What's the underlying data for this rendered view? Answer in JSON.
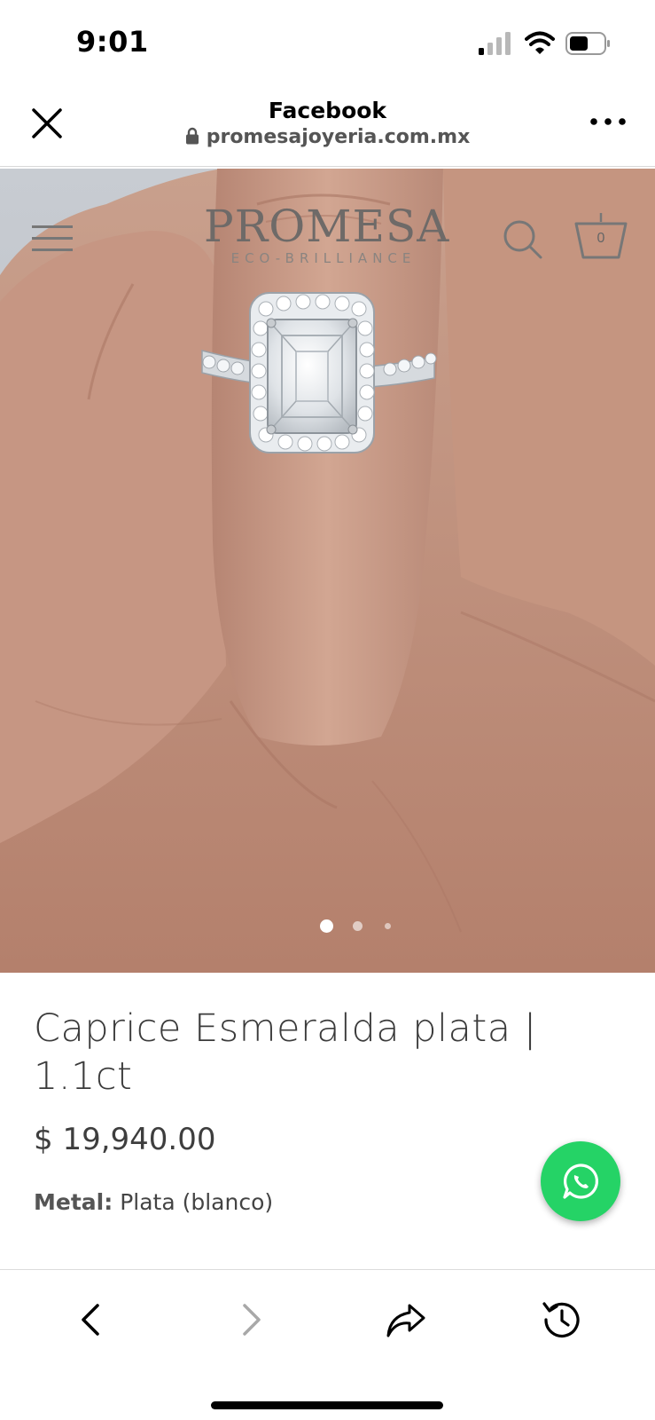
{
  "status_bar": {
    "time": "9:01",
    "icons": [
      "cellular-signal-icon",
      "wifi-icon",
      "battery-icon"
    ]
  },
  "browser_header": {
    "title": "Facebook",
    "url": "promesajoyeria.com.mx",
    "icons": [
      "close-icon",
      "lock-icon",
      "more-icon"
    ]
  },
  "site": {
    "logo_main": "PROMESA",
    "logo_sub": "ECO-BRILLIANCE",
    "cart_count": "0",
    "icons": [
      "menu-icon",
      "search-icon",
      "basket-icon"
    ]
  },
  "carousel": {
    "total_slides": 3,
    "active_index": 0
  },
  "product": {
    "title": "Caprice Esmeralda plata | 1.1ct",
    "price": "$ 19,940.00",
    "metal_label": "Metal:",
    "metal_value": "Plata (blanco)"
  },
  "toolbar": {
    "icons": [
      "back-icon",
      "forward-icon",
      "share-icon",
      "history-icon"
    ]
  },
  "colors": {
    "whatsapp": "#25d366",
    "skin": "#c79982",
    "text_dark": "#3b3b3b"
  }
}
